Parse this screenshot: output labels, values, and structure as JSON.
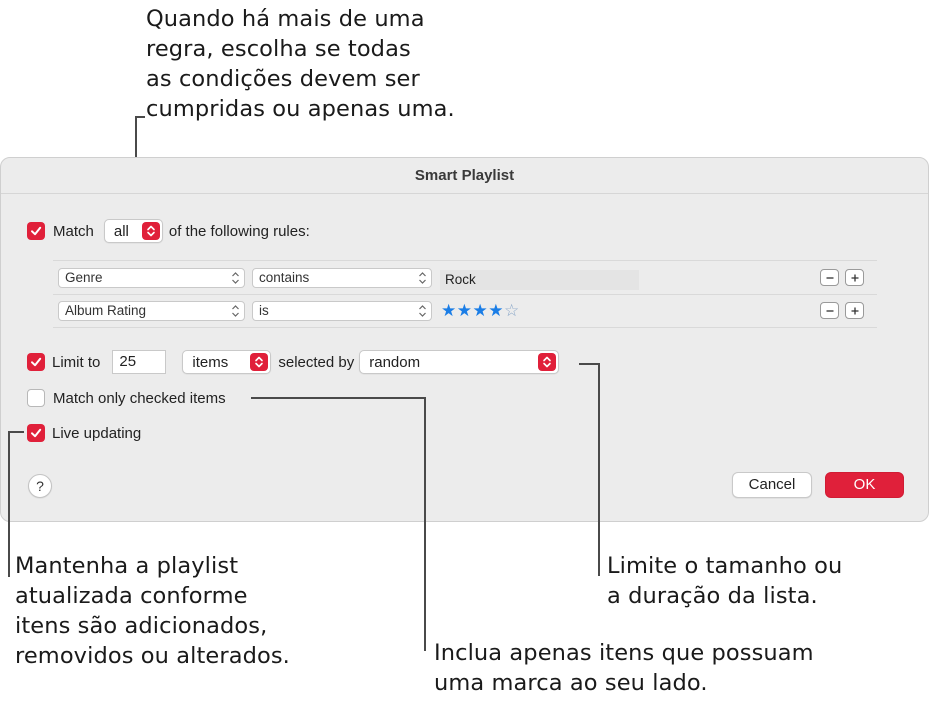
{
  "callouts": {
    "top": [
      "Quando há mais de uma",
      "regra, escolha se todas",
      "as condições devem ser",
      "cumpridas ou apenas uma."
    ],
    "bottom_left": [
      "Mantenha a playlist",
      "atualizada conforme",
      "itens são adicionados,",
      "removidos ou alterados."
    ],
    "bottom_center": [
      "Inclua apenas itens que possuam",
      "uma marca ao seu lado."
    ],
    "bottom_right": [
      "Limite o tamanho ou",
      "a duração da lista."
    ]
  },
  "dialog": {
    "title": "Smart Playlist",
    "match": {
      "checked": true,
      "label": "Match",
      "value": "all",
      "suffix": "of the following rules:"
    },
    "rules": [
      {
        "field": "Genre",
        "operator": "contains",
        "value": "Rock"
      },
      {
        "field": "Album Rating",
        "operator": "is",
        "rating": 4,
        "rating_max": 5,
        "stars_filled": "★★★★",
        "stars_empty": "☆"
      }
    ],
    "limit": {
      "checked": true,
      "label": "Limit to",
      "count": "25",
      "unit": "items",
      "selected_by_label": "selected by",
      "selected_by": "random"
    },
    "match_checked": {
      "checked": false,
      "label": "Match only checked items"
    },
    "live_updating": {
      "checked": true,
      "label": "Live updating"
    },
    "help_label": "?",
    "cancel_label": "Cancel",
    "ok_label": "OK"
  },
  "colors": {
    "accent": "#e0203a",
    "star": "#1a7de6",
    "dialog_bg": "#ececec"
  }
}
